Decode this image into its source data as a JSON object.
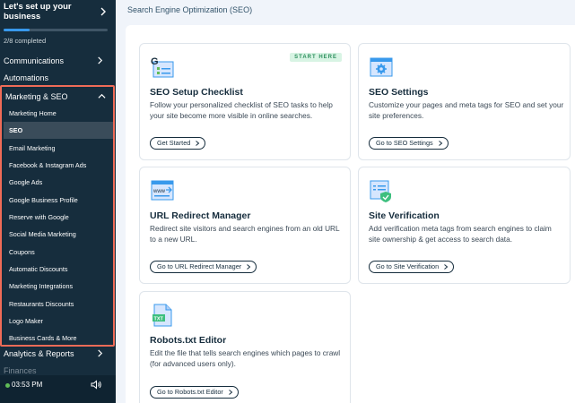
{
  "sidebar": {
    "setup": {
      "title": "Let's set up your business",
      "progress": "2/8 completed",
      "progress_fraction": 0.25
    },
    "top_items": [
      {
        "label": "Communications"
      },
      {
        "label": "Automations"
      }
    ],
    "group": {
      "title": "Marketing & SEO",
      "items": [
        {
          "label": "Marketing Home"
        },
        {
          "label": "SEO"
        },
        {
          "label": "Email Marketing"
        },
        {
          "label": "Facebook & Instagram Ads"
        },
        {
          "label": "Google Ads"
        },
        {
          "label": "Google Business Profile"
        },
        {
          "label": "Reserve with Google"
        },
        {
          "label": "Social Media Marketing"
        },
        {
          "label": "Coupons"
        },
        {
          "label": "Automatic Discounts"
        },
        {
          "label": "Marketing Integrations"
        },
        {
          "label": "Restaurants Discounts"
        },
        {
          "label": "Logo Maker"
        },
        {
          "label": "Business Cards & More"
        }
      ],
      "active_item": "SEO"
    },
    "bottom_items": [
      {
        "label": "Analytics & Reports"
      },
      {
        "label": "Finances"
      }
    ],
    "status": {
      "time": "03:53 PM",
      "online_color": "#60bc57"
    }
  },
  "main": {
    "breadcrumb": "Search Engine Optimization (SEO)",
    "cards": [
      {
        "title": "SEO Setup Checklist",
        "badge": "START HERE",
        "description": "Follow your personalized checklist of SEO tasks to help your site become more visible in online searches.",
        "button": "Get Started",
        "icon": "google-checklist-icon"
      },
      {
        "title": "SEO Settings",
        "description": "Customize your pages and meta tags for SEO and set your site preferences.",
        "button": "Go to SEO Settings",
        "icon": "gear-page-icon"
      },
      {
        "title": "URL Redirect Manager",
        "description": "Redirect site visitors and search engines from an old URL to a new URL.",
        "button": "Go to URL Redirect Manager",
        "icon": "www-redirect-icon"
      },
      {
        "title": "Site Verification",
        "description": "Add verification meta tags from search engines to claim site ownership & get access to search data.",
        "button": "Go to Site Verification",
        "icon": "verified-shield-icon"
      },
      {
        "title": "Robots.txt Editor",
        "description": "Edit the file that tells search engines which pages to crawl (for advanced users only).",
        "button": "Go to Robots.txt Editor",
        "icon": "txt-file-icon"
      }
    ]
  },
  "colors": {
    "sidebar": "#162d3d",
    "highlight_border": "#ef6b57",
    "accent": "#3899ec",
    "badge_bg": "#d8f4e4",
    "badge_text": "#2e8f5e"
  }
}
